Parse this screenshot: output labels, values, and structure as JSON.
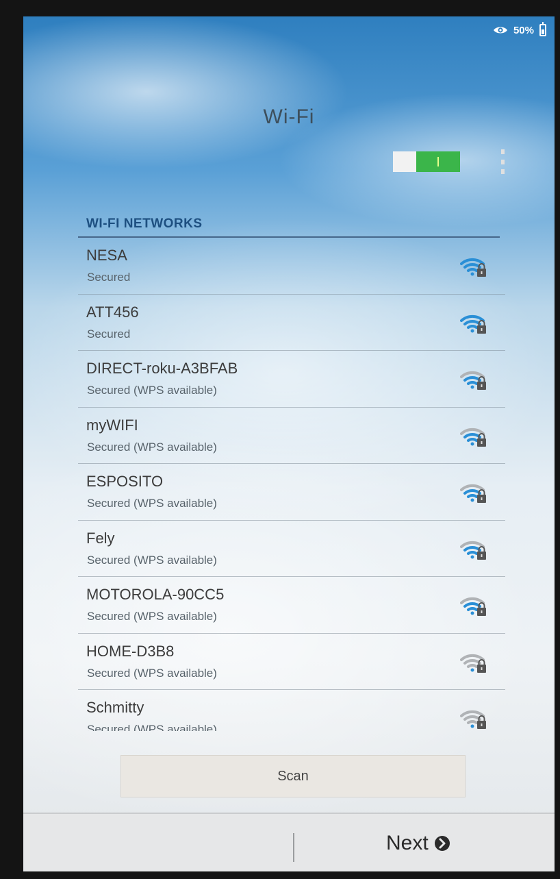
{
  "status_bar": {
    "battery_text": "50%",
    "icons": [
      "eye-icon",
      "battery-icon"
    ]
  },
  "header": {
    "title": "Wi-Fi",
    "wifi_enabled": true,
    "menu_icon": "overflow-menu-icon"
  },
  "networks_section": {
    "title": "WI-FI NETWORKS",
    "items": [
      {
        "name": "NESA",
        "status": "Secured",
        "signal": 4
      },
      {
        "name": "ATT456",
        "status": "Secured",
        "signal": 4
      },
      {
        "name": "DIRECT-roku-A3BFAB",
        "status": "Secured (WPS available)",
        "signal": 3
      },
      {
        "name": "myWIFI",
        "status": "Secured (WPS available)",
        "signal": 3
      },
      {
        "name": "ESPOSITO",
        "status": "Secured (WPS available)",
        "signal": 3
      },
      {
        "name": "Fely",
        "status": "Secured (WPS available)",
        "signal": 3
      },
      {
        "name": "MOTOROLA-90CC5",
        "status": "Secured (WPS available)",
        "signal": 3
      },
      {
        "name": "HOME-D3B8",
        "status": "Secured (WPS available)",
        "signal": 1
      },
      {
        "name": "Schmitty",
        "status": "Secured (WPS available)",
        "signal": 1
      }
    ]
  },
  "actions": {
    "scan_label": "Scan",
    "next_label": "Next"
  },
  "colors": {
    "section_title": "#1d4f80",
    "toggle_on": "#3bb54a",
    "wifi_strong": "#2a8fd6",
    "wifi_weak": "#b0b3b6"
  }
}
